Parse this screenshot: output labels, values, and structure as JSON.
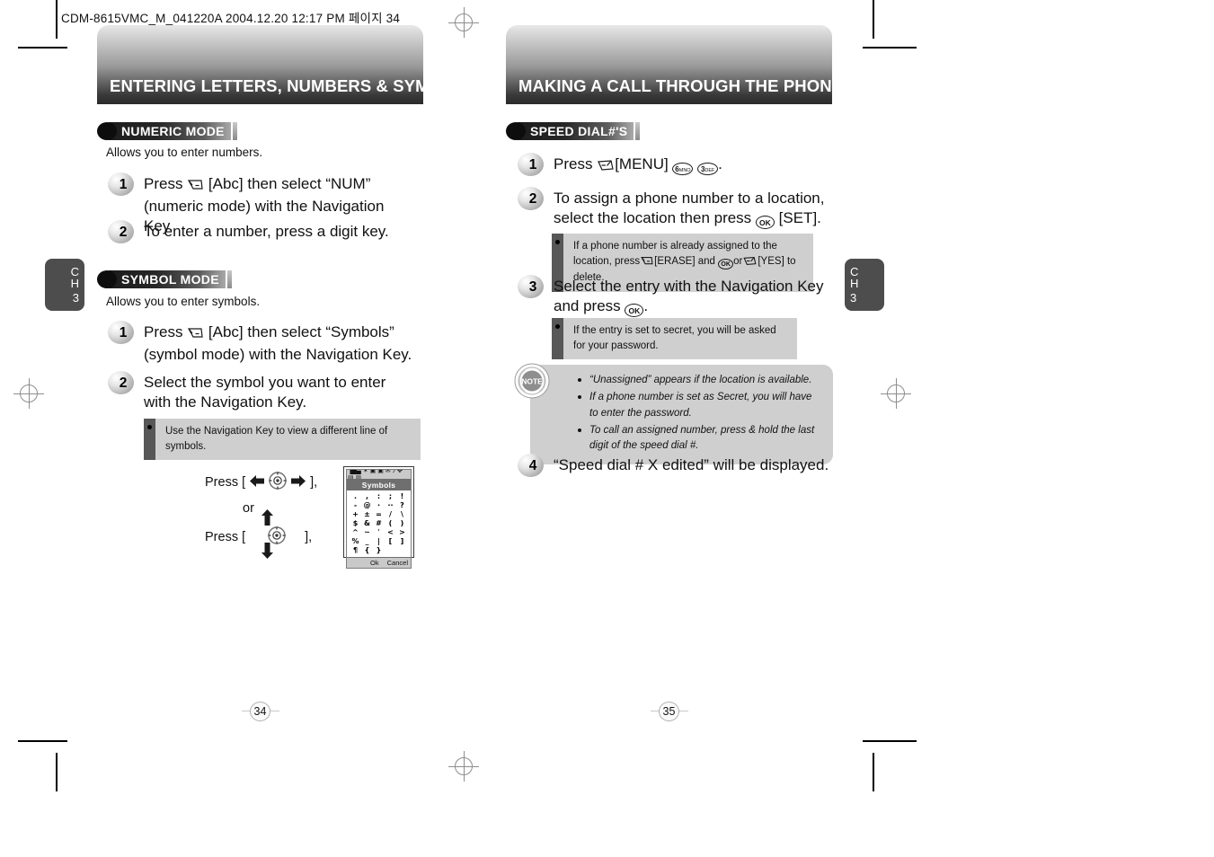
{
  "film_header": "CDM-8615VMC_M_041220A  2004.12.20 12:17 PM 페이지 34",
  "left_page": {
    "banner_title": "ENTERING LETTERS, NUMBERS & SYMBOLS",
    "page_number": "34",
    "chapter_tab": {
      "line1": "C",
      "line2": "H",
      "line3": "3"
    },
    "sections": [
      {
        "label": "NUMERIC MODE",
        "description": "Allows you to enter numbers.",
        "steps": [
          {
            "num": "1",
            "text_a": "Press ",
            "key": "abc-soft-key",
            "text_b": " [Abc] then select “NUM” (numeric mode) with the Navigation Key."
          },
          {
            "num": "2",
            "text_a": "To enter a number, press a digit key.",
            "key": "",
            "text_b": ""
          }
        ]
      },
      {
        "label": "SYMBOL MODE",
        "description": "Allows you to enter symbols.",
        "steps": [
          {
            "num": "1",
            "text_a": "Press ",
            "key": "abc-soft-key",
            "text_b": " [Abc] then select “Symbols” (symbol mode) with the Navigation Key."
          },
          {
            "num": "2",
            "text_a": "Select the symbol you want to enter with the Navigation Key.",
            "key": "",
            "text_b": ""
          }
        ],
        "tip": "Use the Navigation Key to view a different line of symbols."
      }
    ],
    "press_illustration": {
      "line1_prefix": "Press [",
      "line1_suffix": "],",
      "or_label": "or",
      "line2_prefix": "Press [",
      "line2_suffix": "],"
    },
    "lcd": {
      "status_icons": "▐█▄ ✶ ▣ ▣ ✉ ♪ ✥ ▤ ▥",
      "title": "Symbols",
      "rows": [
        [
          ".",
          ",",
          ":",
          ";",
          "!"
        ],
        [
          "-",
          "@",
          "·",
          "··",
          "?"
        ],
        [
          "+",
          "±",
          "=",
          "/",
          "\\"
        ],
        [
          "$",
          "&",
          "#",
          "(",
          ")"
        ],
        [
          "^",
          "~",
          "ˈ",
          "<",
          ">"
        ],
        [
          "%",
          "_",
          "|",
          "[",
          "]"
        ],
        [
          "¶",
          "{",
          "}",
          "",
          ""
        ]
      ],
      "softkey_left": "Ok",
      "softkey_right": "Cancel"
    }
  },
  "right_page": {
    "banner_title": "MAKING A CALL THROUGH THE PHONEBOOK",
    "page_number": "35",
    "chapter_tab": {
      "line1": "C",
      "line2": "H",
      "line3": "3"
    },
    "section_label": "SPEED DIAL#'S",
    "steps": [
      {
        "num": "1",
        "text": "Press",
        "menu_label": "[MENU]",
        "key_6": "6",
        "key_6_sub": "MNO",
        "key_3": "3",
        "key_3_sub": "DEF",
        "trailing": "."
      },
      {
        "num": "2",
        "text": "To assign a phone number to a location, select the location then press",
        "set_label": "[SET].",
        "ok_label": "OK"
      },
      {
        "num": "3",
        "text": "Select the entry with the Navigation Key and press",
        "trailing": ".",
        "ok_label": "OK"
      },
      {
        "num": "4",
        "text": "“Speed dial # X edited” will be displayed."
      }
    ],
    "tips": [
      {
        "line1": "If a phone number is already assigned to the",
        "line2_a": "location, press",
        "erase_label": "[ERASE] and",
        "ok_label": "OK",
        "line2_b": "or",
        "yes_label": "[YES] to delete."
      },
      {
        "line1": "If the entry is set to secret, you will be asked for your password."
      }
    ],
    "note": {
      "badge_label": "NOTE",
      "items": [
        "“Unassigned” appears if the location is available.",
        "If a phone number is set as Secret, you will have to enter the password.",
        "To call an assigned number, press & hold the last digit of the speed dial #."
      ]
    }
  }
}
